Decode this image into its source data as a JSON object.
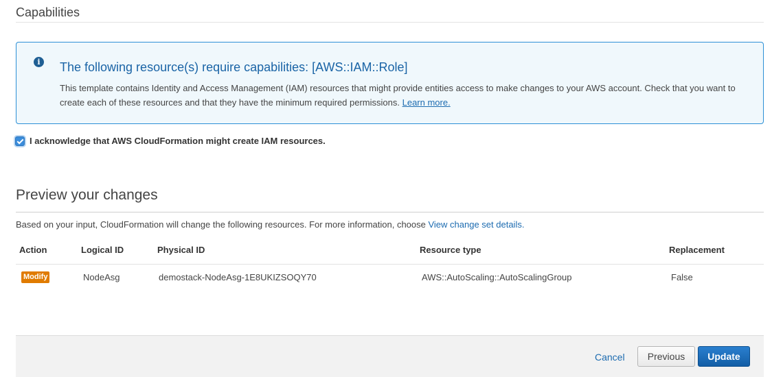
{
  "capabilities": {
    "title": "Capabilities",
    "info_title": "The following resource(s) require capabilities: [AWS::IAM::Role]",
    "info_body": "This template contains Identity and Access Management (IAM) resources that might provide entities access to make changes to your AWS account. Check that you want to create each of these resources and that they have the minimum required permissions.",
    "learn_more": "Learn more.",
    "acknowledge": "I acknowledge that AWS CloudFormation might create IAM resources."
  },
  "preview": {
    "title": "Preview your changes",
    "description": "Based on your input, CloudFormation will change the following resources. For more information, choose",
    "details_link": "View change set details.",
    "columns": [
      "Action",
      "Logical ID",
      "Physical ID",
      "Resource type",
      "Replacement"
    ],
    "rows": [
      {
        "action": "Modify",
        "logical_id": "NodeAsg",
        "physical_id": "demostack-NodeAsg-1E8UKIZSOQY70",
        "resource_type": "AWS::AutoScaling::AutoScalingGroup",
        "replacement": "False"
      }
    ]
  },
  "footer": {
    "cancel": "Cancel",
    "previous": "Previous",
    "update": "Update"
  }
}
